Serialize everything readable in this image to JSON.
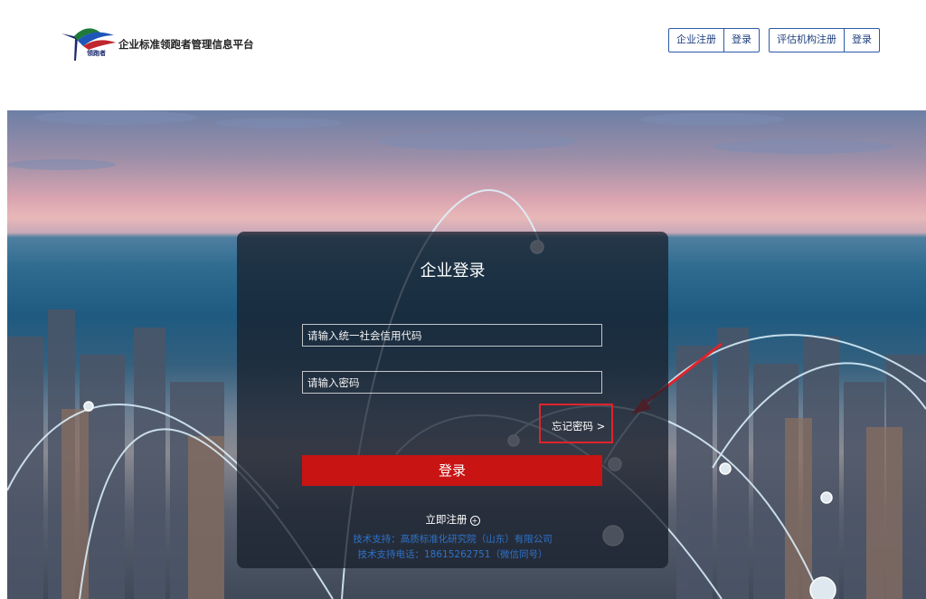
{
  "header": {
    "logo_sub": "领跑者",
    "site_title": "企业标准领跑者管理信息平台",
    "enterprise_group": {
      "register": "企业注册",
      "login": "登录"
    },
    "agency_group": {
      "register": "评估机构注册",
      "login": "登录"
    }
  },
  "login_card": {
    "title": "企业登录",
    "credit_code_placeholder": "请输入统一社会信用代码",
    "password_placeholder": "请输入密码",
    "forgot_password": "忘记密码 >",
    "login_button": "登录",
    "register_link": "立即注册",
    "support_line_1": "技术支持：高质标准化研究院（山东）有限公司",
    "support_line_2": "技术支持电话：18615262751（微信同号）"
  },
  "colors": {
    "accent_red": "#c91414",
    "annotation_red": "#e0232a",
    "header_button_blue": "#2b5aa8",
    "support_text_blue": "#2d72c9"
  },
  "icons": [
    "flag-logo-icon",
    "plus-circle-icon",
    "red-arrow-annotation"
  ]
}
